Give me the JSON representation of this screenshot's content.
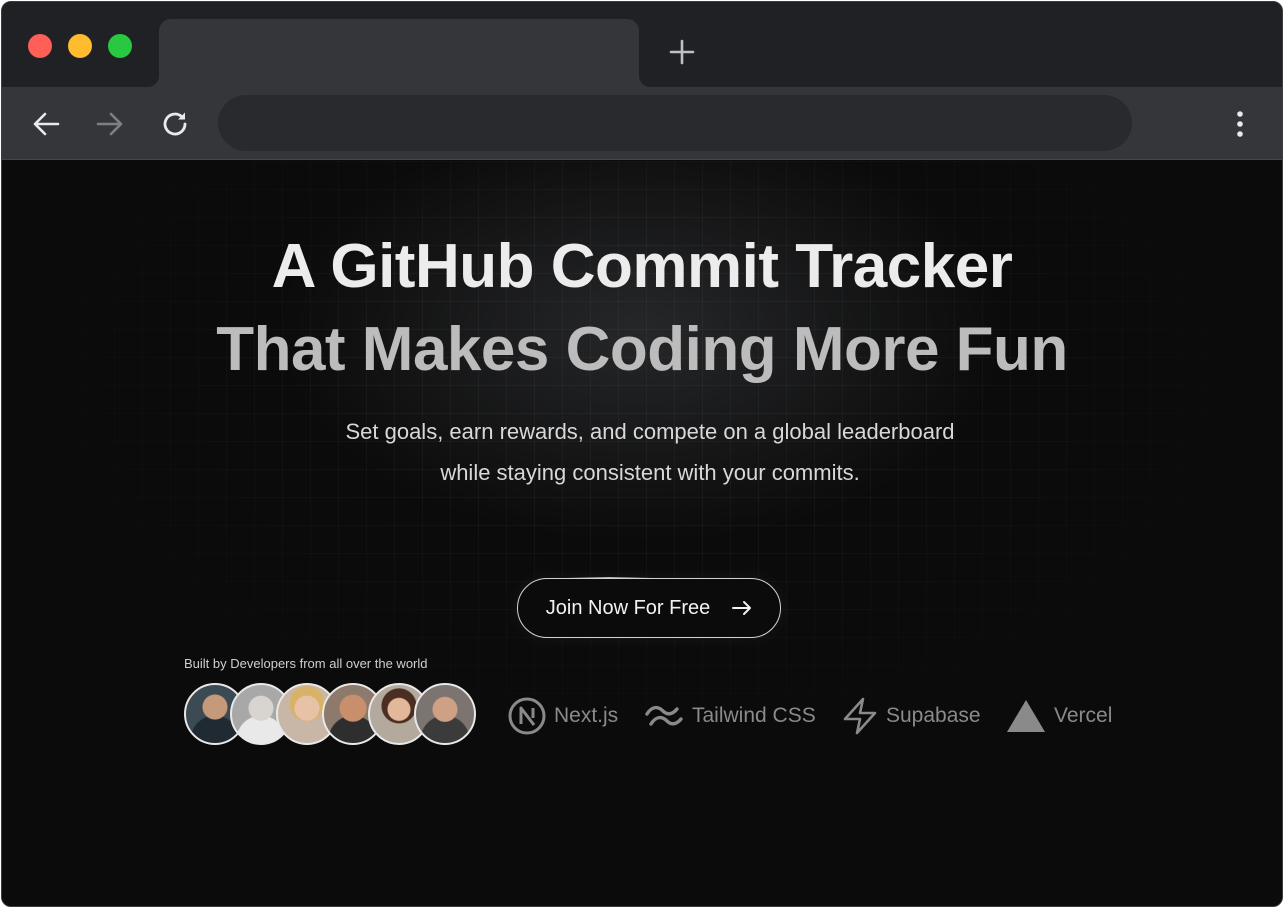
{
  "browser": {
    "traffic_lights": {
      "close": "#fe5f57",
      "minimize": "#febc2e",
      "maximize": "#28c840"
    },
    "new_tab_icon": "plus-icon",
    "toolbar": {
      "back_icon": "arrow-left-icon",
      "forward_icon": "arrow-right-icon",
      "reload_icon": "reload-icon",
      "menu_icon": "vertical-dots-icon",
      "address": ""
    }
  },
  "hero": {
    "headline_line1": "A GitHub Commit Tracker",
    "headline_line2": "That Makes Coding More Fun",
    "subtitle": "Set goals, earn rewards, and compete on a global leaderboard while staying consistent with your commits.",
    "cta_label": "Join Now For Free",
    "cta_icon": "arrow-right-icon"
  },
  "social_proof": {
    "built_by": "Built by Developers from all over the world",
    "avatar_count": 6
  },
  "tech_stack": [
    {
      "label": "Next.js",
      "icon": "nextjs-logo-icon"
    },
    {
      "label": "Tailwind CSS",
      "icon": "tailwind-logo-icon"
    },
    {
      "label": "Supabase",
      "icon": "supabase-bolt-icon"
    },
    {
      "label": "Vercel",
      "icon": "vercel-triangle-icon"
    }
  ],
  "colors": {
    "page_bg": "#0b0b0b",
    "headline_primary": "#ececec",
    "headline_secondary": "#bcbcbc",
    "tech_text": "#8a8a8a"
  }
}
